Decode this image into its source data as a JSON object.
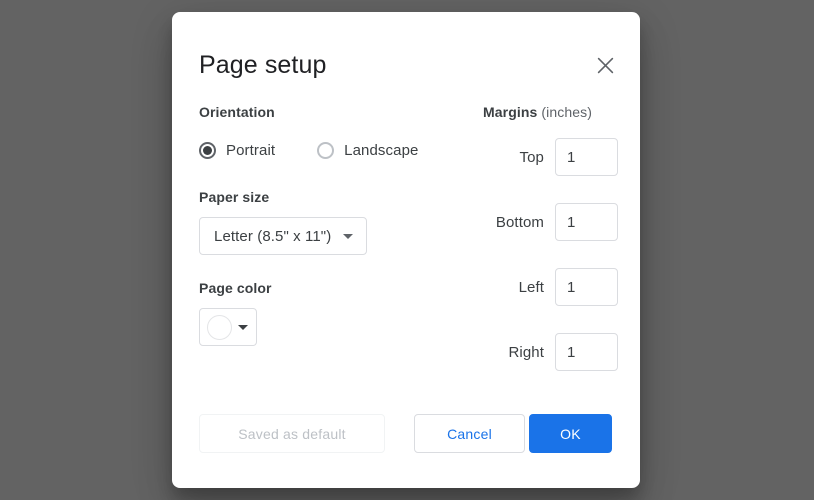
{
  "dialog": {
    "title": "Page setup",
    "close_icon": "close-icon"
  },
  "orientation": {
    "label": "Orientation",
    "options": [
      {
        "label": "Portrait",
        "selected": true
      },
      {
        "label": "Landscape",
        "selected": false
      }
    ]
  },
  "paper_size": {
    "label": "Paper size",
    "value": "Letter (8.5\" x 11\")",
    "caret_icon": "chevron-down-icon"
  },
  "page_color": {
    "label": "Page color",
    "value": "#ffffff",
    "caret_icon": "chevron-down-icon"
  },
  "margins": {
    "label": "Margins",
    "units": "(inches)",
    "fields": [
      {
        "name": "Top",
        "value": "1"
      },
      {
        "name": "Bottom",
        "value": "1"
      },
      {
        "name": "Left",
        "value": "1"
      },
      {
        "name": "Right",
        "value": "1"
      }
    ]
  },
  "footer": {
    "saved_default_label": "Saved as default",
    "cancel_label": "Cancel",
    "ok_label": "OK"
  },
  "colors": {
    "accent": "#1a73e8",
    "backdrop": "#636363",
    "dialog_bg": "#ffffff",
    "text_primary": "#3c4043",
    "text_secondary": "#5f6368",
    "border": "#dadce0",
    "disabled_text": "#bdc1c6"
  }
}
